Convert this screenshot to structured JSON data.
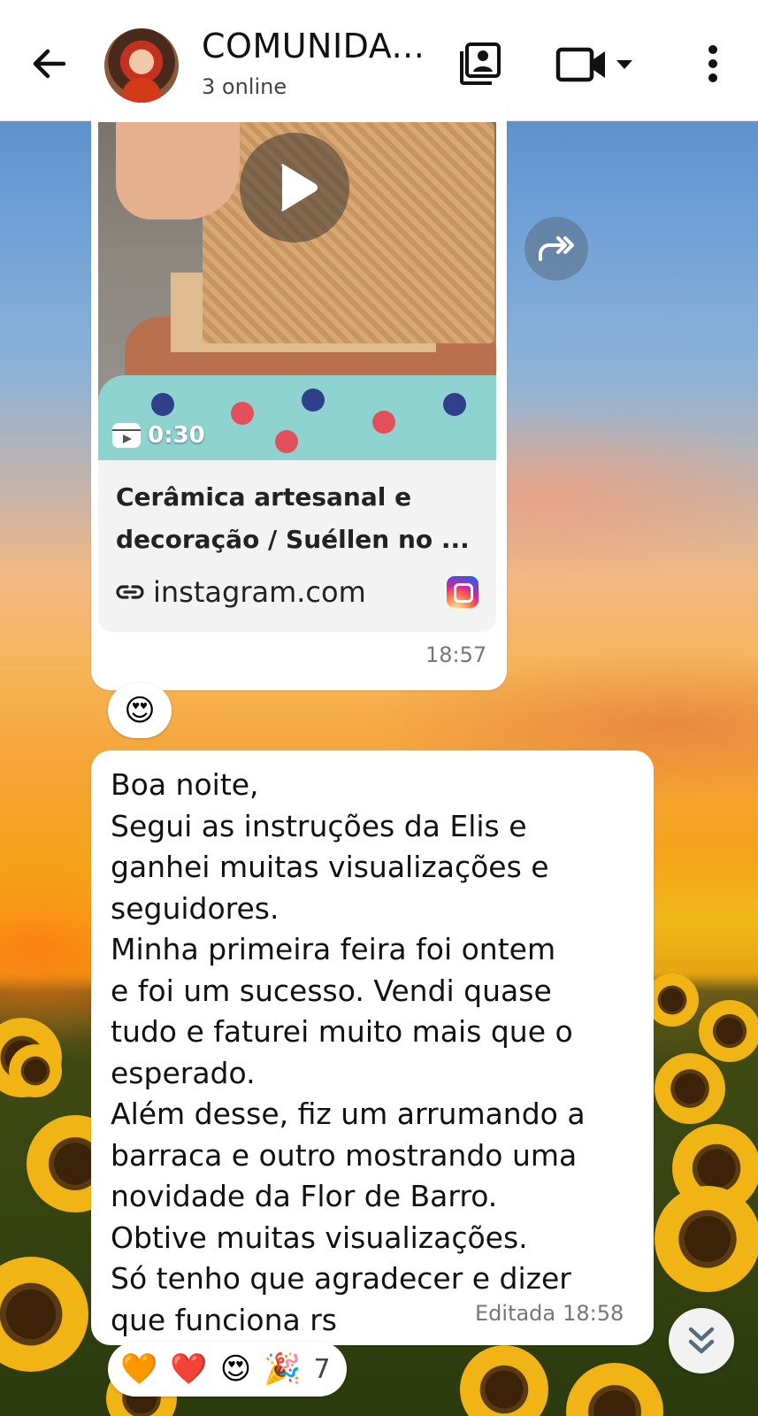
{
  "header": {
    "title": "COMUNIDA...",
    "subtitle": "3 online"
  },
  "icons": {
    "back": "arrow-left-icon",
    "gallery": "contact-card-icon",
    "video_call": "video-camera-icon",
    "video_dropdown": "caret-down-icon",
    "more": "more-vertical-icon",
    "forward": "forward-icon",
    "play": "play-icon",
    "reel": "reel-icon",
    "link": "link-icon",
    "instagram": "instagram-icon",
    "scroll_down": "double-chevron-down-icon"
  },
  "link_message": {
    "video_duration": "0:30",
    "title": "Cerâmica artesanal e decoração / Suéllen no ...",
    "domain": "instagram.com",
    "time": "18:57",
    "reaction": "😍"
  },
  "text_message": {
    "body": "Boa noite,\nSegui as instruções da Elis e\nganhei muitas visualizações e\nseguidores.\nMinha primeira feira foi ontem\ne foi um sucesso. Vendi quase\ntudo e faturei muito mais que o\nesperado.\nAlém desse, fiz um arrumando a\nbarraca e outro mostrando uma\nnovidade da Flor de Barro.\nObtive muitas visualizações.\nSó tenho que agradecer e dizer\nque funciona rs",
    "edited_label": "Editada",
    "time": "18:58",
    "reactions": [
      "🧡",
      "❤️",
      "😍",
      "🎉"
    ],
    "reaction_count": "7"
  },
  "colors": {
    "header_bg": "#ffffff",
    "bubble_bg": "#ffffff",
    "link_card_bg": "#f4f3f3",
    "meta_text": "#777777"
  }
}
